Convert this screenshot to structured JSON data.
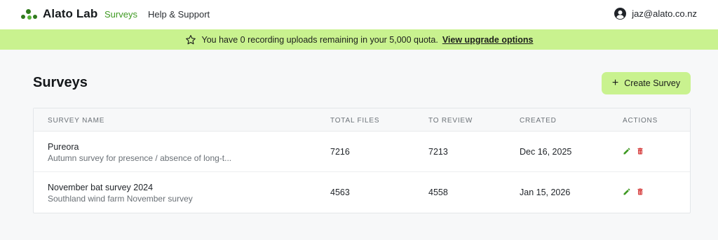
{
  "header": {
    "brand": "Alato Lab",
    "nav": [
      {
        "label": "Surveys"
      },
      {
        "label": "Help & Support"
      }
    ],
    "user_email": "jaz@alato.co.nz"
  },
  "banner": {
    "message": "You have 0 recording uploads remaining in your 5,000 quota.",
    "link_label": "View upgrade options"
  },
  "page": {
    "title": "Surveys",
    "create_button_label": "Create Survey"
  },
  "table": {
    "columns": [
      "Survey Name",
      "Total Files",
      "To Review",
      "Created",
      "Actions"
    ],
    "rows": [
      {
        "name": "Pureora",
        "description": "Autumn survey for presence / absence of long-t...",
        "total_files": "7216",
        "to_review": "7213",
        "created": "Dec 16, 2025"
      },
      {
        "name": "November bat survey 2024",
        "description": "Southland wind farm November survey",
        "total_files": "4563",
        "to_review": "4558",
        "created": "Jan 15, 2026"
      }
    ]
  },
  "colors": {
    "accent_green": "#3f9a23",
    "banner_bg": "#c9f28f",
    "edit_icon": "#3f9a23",
    "delete_icon": "#d32f2f"
  },
  "icons": [
    "alato-logo-icon",
    "user-avatar-icon",
    "star-icon",
    "plus-icon",
    "edit-icon",
    "delete-icon"
  ]
}
